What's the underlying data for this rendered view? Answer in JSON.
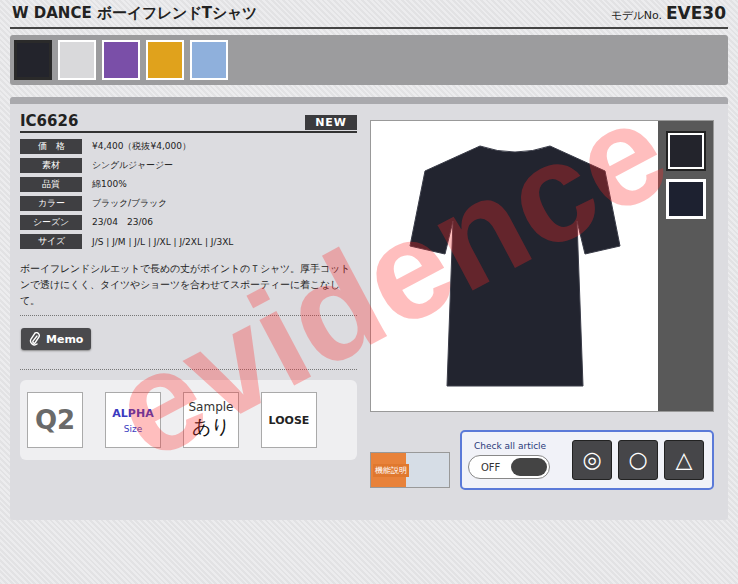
{
  "header": {
    "title": "W DANCE ボーイフレンドTシャツ",
    "model_label": "モデルNo.",
    "model_no": "EVE30"
  },
  "color_swatches": [
    {
      "color": "#23242c",
      "selected": true
    },
    {
      "color": "#d9d9db",
      "selected": false
    },
    {
      "color": "#7a4fa8",
      "selected": false
    },
    {
      "color": "#e0a21c",
      "selected": false
    },
    {
      "color": "#8fb0dc",
      "selected": false
    }
  ],
  "product": {
    "code": "IC6626",
    "badge": "NEW",
    "specs": [
      {
        "label": "価　格",
        "value": "¥4,400（税抜¥4,000）"
      },
      {
        "label": "素材",
        "value": "シングルジャージー"
      },
      {
        "label": "品質",
        "value": "綿100%"
      },
      {
        "label": "カラー",
        "value": "ブラック/ブラック"
      },
      {
        "label": "シーズン",
        "value": "23/04　23/06"
      },
      {
        "label": "サイズ",
        "value": "J/S | J/M | J/L | J/XL | J/2XL | J/3XL"
      }
    ],
    "description": "ボーイフレンドシルエットで長めの丈がポイントのＴシャツ。厚手コットンで透けにくく、タイツやショーツを合わせてスポーティーに着こなして。",
    "memo_button": "Memo"
  },
  "features": [
    {
      "kind": "big",
      "lines": [
        "Q2"
      ]
    },
    {
      "kind": "alpha",
      "lines": [
        "ALPHA",
        "Size"
      ]
    },
    {
      "kind": "sample",
      "lines": [
        "Sample",
        "あり"
      ]
    },
    {
      "kind": "word",
      "lines": [
        "LOOSE"
      ]
    }
  ],
  "gallery": {
    "thumbnails": [
      {
        "color": "#23242c",
        "selected": true
      },
      {
        "color": "#1d2130",
        "selected": false
      }
    ]
  },
  "function_button": "機能説明",
  "check_all": {
    "label": "Check all article",
    "toggle": "OFF",
    "on": false,
    "buttons": [
      "◎",
      "○",
      "△"
    ]
  },
  "watermark": "evidence"
}
